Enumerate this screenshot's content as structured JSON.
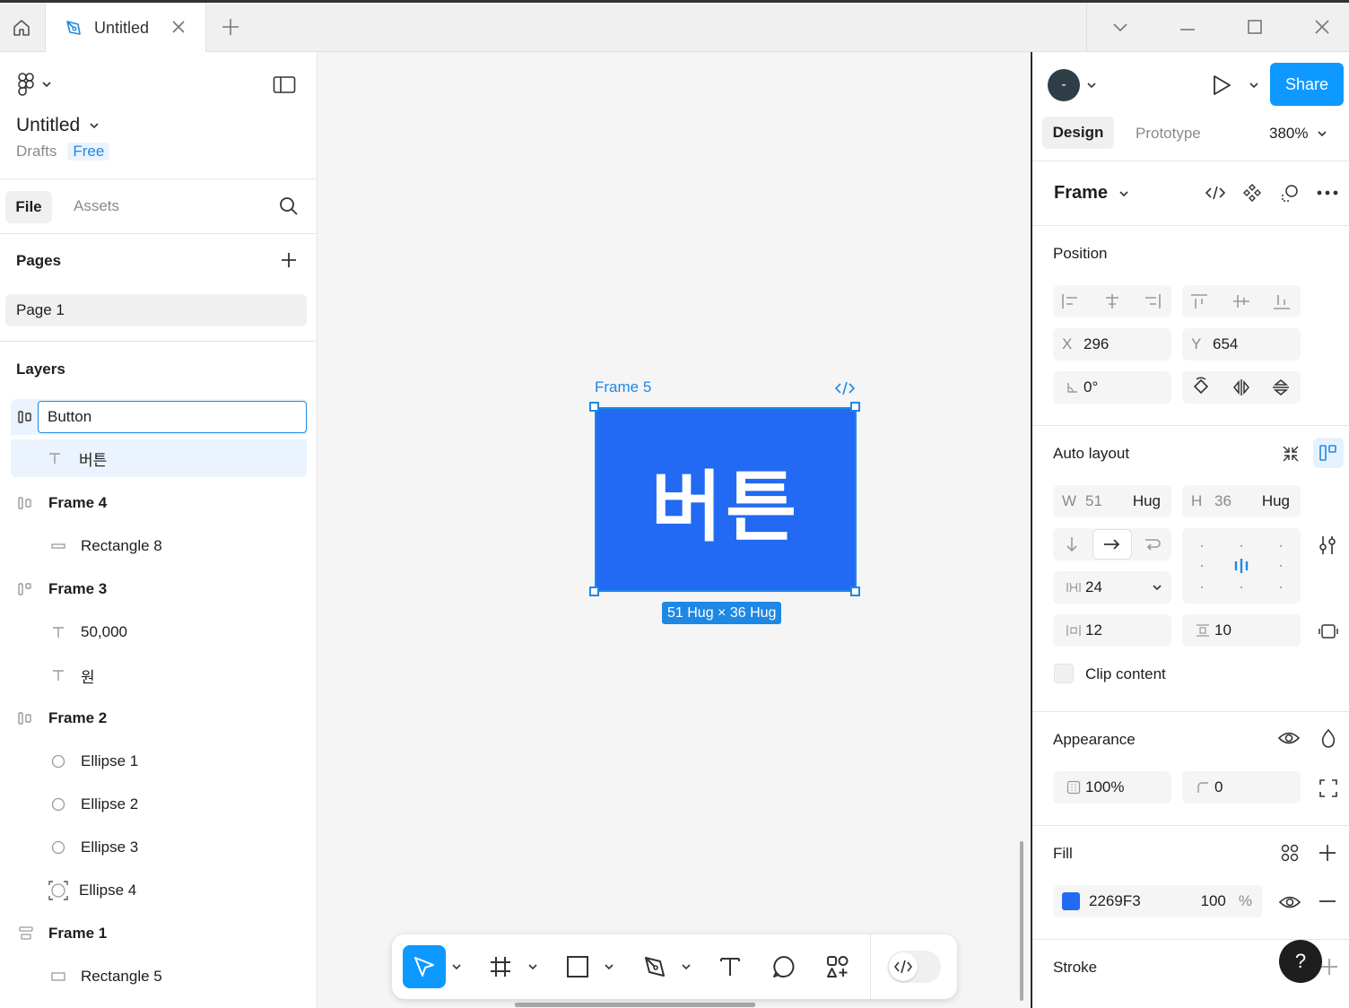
{
  "titlebar": {
    "tab_title": "Untitled"
  },
  "left_panel": {
    "file_name": "Untitled",
    "location": "Drafts",
    "plan": "Free",
    "tabs": {
      "file": "File",
      "assets": "Assets"
    },
    "pages_title": "Pages",
    "current_page": "Page 1",
    "layers_title": "Layers",
    "layers": [
      {
        "name": "Button",
        "type": "frame-autolayout",
        "editing": true
      },
      {
        "name": "버튼",
        "type": "text"
      },
      {
        "name": "Frame 4",
        "type": "frame-autolayout"
      },
      {
        "name": "Rectangle 8",
        "type": "rectangle"
      },
      {
        "name": "Frame 3",
        "type": "frame-autolayout"
      },
      {
        "name": "50,000",
        "type": "text"
      },
      {
        "name": "원",
        "type": "text"
      },
      {
        "name": "Frame 2",
        "type": "frame-autolayout"
      },
      {
        "name": "Ellipse 1",
        "type": "ellipse"
      },
      {
        "name": "Ellipse 2",
        "type": "ellipse"
      },
      {
        "name": "Ellipse 3",
        "type": "ellipse"
      },
      {
        "name": "Ellipse 4",
        "type": "ellipse-mask"
      },
      {
        "name": "Frame 1",
        "type": "frame-vertical"
      },
      {
        "name": "Rectangle 5",
        "type": "rectangle"
      }
    ]
  },
  "canvas": {
    "frame_label": "Frame 5",
    "button_text": "버튼",
    "fill_color": "#2269F3",
    "size_badge": "51 Hug × 36 Hug"
  },
  "right_panel": {
    "avatar_letter": "-",
    "share_label": "Share",
    "tabs": {
      "design": "Design",
      "prototype": "Prototype"
    },
    "zoom": "380%",
    "selection_type": "Frame",
    "position": {
      "title": "Position",
      "x_label": "X",
      "x": "296",
      "y_label": "Y",
      "y": "654",
      "rotation": "0°"
    },
    "auto_layout": {
      "title": "Auto layout",
      "w_label": "W",
      "w": "51",
      "w_mode": "Hug",
      "h_label": "H",
      "h": "36",
      "h_mode": "Hug",
      "gap": "24",
      "padding_h": "12",
      "padding_v": "10",
      "clip_content": "Clip content"
    },
    "appearance": {
      "title": "Appearance",
      "opacity": "100%",
      "radius": "0"
    },
    "fill": {
      "title": "Fill",
      "hex": "2269F3",
      "opacity": "100",
      "unit": "%"
    },
    "stroke": {
      "title": "Stroke"
    },
    "help": "?"
  }
}
